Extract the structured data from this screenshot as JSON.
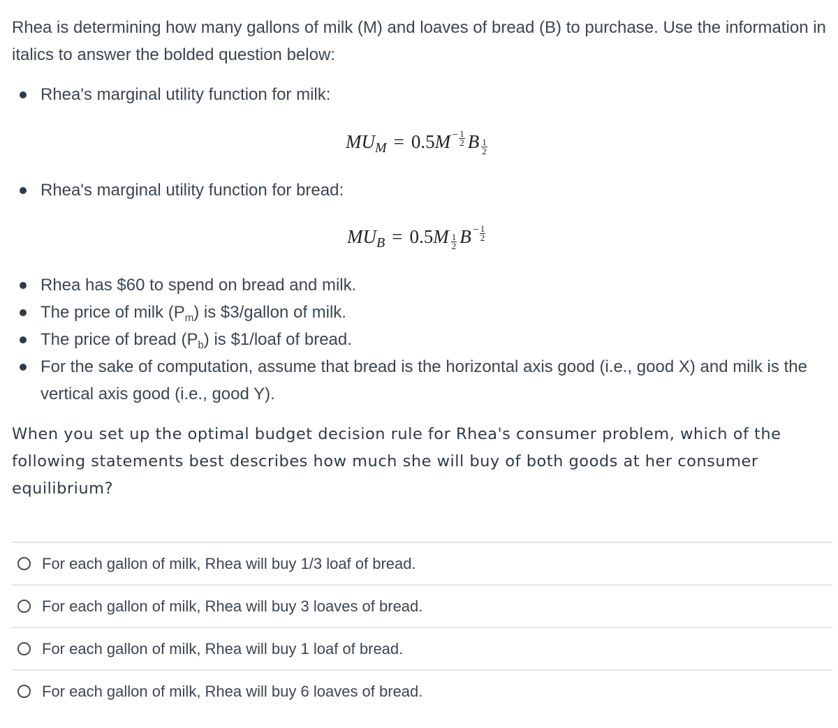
{
  "intro": "Rhea is determining how many gallons of milk (M) and loaves of bread (B) to purchase. Use the information in italics to answer the bolded question below:",
  "bullets": {
    "milk_mu_label": "Rhea's marginal utility function for milk:",
    "bread_mu_label": "Rhea's marginal utility function for bread:",
    "budget": "Rhea has $60 to spend on bread and milk.",
    "price_milk": {
      "before": "The price of milk (P",
      "sub": "m",
      "after": ") is $3/gallon of milk."
    },
    "price_bread": {
      "before": "The price of bread (P",
      "sub": "b",
      "after": ") is $1/loaf of bread."
    },
    "axis_note": "For the sake of computation, assume that bread is the horizontal axis good (i.e., good X) and milk is the vertical axis good (i.e., good Y)."
  },
  "equations": {
    "mu_milk": {
      "lhs": "MU",
      "lhs_sub": "M",
      "equals": "=",
      "coef": "0.5",
      "var1": "M",
      "exp1_sign": "−",
      "exp1_num": "1",
      "exp1_den": "2",
      "var2": "B",
      "exp2_sign": "",
      "exp2_num": "1",
      "exp2_den": "2"
    },
    "mu_bread": {
      "lhs": "MU",
      "lhs_sub": "B",
      "equals": "=",
      "coef": "0.5",
      "var1": "M",
      "exp1_sign": "",
      "exp1_num": "1",
      "exp1_den": "2",
      "var2": "B",
      "exp2_sign": "−",
      "exp2_num": "1",
      "exp2_den": "2"
    }
  },
  "question": "When you set up the optimal budget decision rule for Rhea's consumer problem, which of the following statements best describes how much she will buy of both goods at her consumer equilibrium?",
  "answers": [
    {
      "label": "For each gallon of milk, Rhea will buy 1/3 loaf of bread.",
      "selected": false
    },
    {
      "label": "For each gallon of milk, Rhea will buy 3 loaves of bread.",
      "selected": false
    },
    {
      "label": "For each gallon of milk, Rhea will buy 1 loaf of bread.",
      "selected": false
    },
    {
      "label": "For each gallon of milk, Rhea will buy 6 loaves of bread.",
      "selected": false
    }
  ]
}
